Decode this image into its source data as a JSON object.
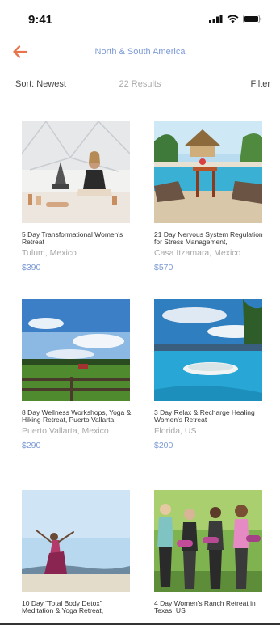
{
  "status_bar": {
    "time": "9:41"
  },
  "nav": {
    "title": "North & South America"
  },
  "toolbar": {
    "sort_label": "Sort: Newest",
    "results": "22 Results",
    "filter_label": "Filter"
  },
  "retreats": [
    {
      "title": "5 Day Transformational Women's Retreat",
      "location": "Tulum, Mexico",
      "price": "$390"
    },
    {
      "title": "21 Day Nervous System Regulation for Stress Management,",
      "location": "Casa Itzamara, Mexico",
      "price": "$570"
    },
    {
      "title": "8 Day Wellness Workshops, Yoga & Hiking Retreat, Puerto Vallarta",
      "location": "Puerto Vallarta, Mexico",
      "price": "$290"
    },
    {
      "title": "3 Day Relax & Recharge Healing Women's Retreat",
      "location": "Florida, US",
      "price": "$200"
    },
    {
      "title": "10 Day \"Total Body Detox\" Meditation & Yoga Retreat,",
      "location": "",
      "price": ""
    },
    {
      "title": "4 Day Women's Ranch Retreat in Texas, US",
      "location": "",
      "price": ""
    }
  ],
  "colors": {
    "accent": "#e9734a",
    "link": "#7c9ad6",
    "muted": "#a8a8a8"
  }
}
